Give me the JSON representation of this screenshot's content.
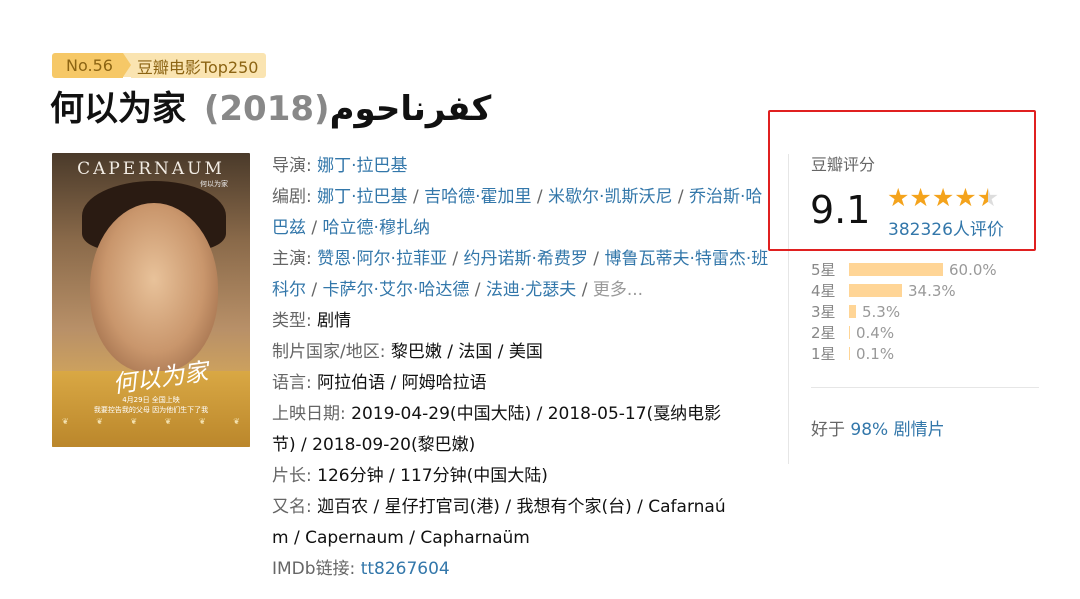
{
  "badge": {
    "rank": "No.56",
    "list": "豆瓣电影Top250"
  },
  "title": {
    "name": "何以为家 كفرناحوم",
    "year": "(2018)"
  },
  "poster": {
    "title_en": "CAPERNAUM",
    "title_en_sub": "何以为家",
    "title_zh": "何以为家",
    "release_line": "4月29日 全国上映",
    "tagline": "我要控告我的父母 因为他们生下了我"
  },
  "info": {
    "director_label": "导演: ",
    "director": "娜丁·拉巴基",
    "writer_label": "编剧: ",
    "writers": [
      "娜丁·拉巴基",
      "吉哈德·霍加里",
      "米歇尔·凯斯沃尼",
      "乔治斯·哈巴兹",
      "哈立德·穆扎纳"
    ],
    "cast_label": "主演: ",
    "cast": [
      "赞恩·阿尔·拉菲亚",
      "约丹诺斯·希费罗",
      "博鲁瓦蒂夫·特雷杰·班科尔",
      "卡萨尔·艾尔·哈达德",
      "法迪·尤瑟夫"
    ],
    "more": "更多...",
    "genre_label": "类型: ",
    "genre": "剧情",
    "country_label": "制片国家/地区: ",
    "country": "黎巴嫩 / 法国 / 美国",
    "language_label": "语言: ",
    "language": "阿拉伯语 / 阿姆哈拉语",
    "release_label": "上映日期: ",
    "release_line1": "2019-04-29(中国大陆) / 2018-05-17(戛纳电影",
    "release_line2": "节) / 2018-09-20(黎巴嫩)",
    "runtime_label": "片长: ",
    "runtime": "126分钟 / 117分钟(中国大陆)",
    "aka_label": "又名: ",
    "aka_line1": "迦百农 / 星仔打官司(港) / 我想有个家(台) / Cafarnaú",
    "aka_line2": "m / Capernaum / Capharnaüm",
    "imdb_label": "IMDb链接: ",
    "imdb": "tt8267604",
    "sep": " / "
  },
  "rating": {
    "label": "豆瓣评分",
    "score": "9.1",
    "stars": 4.5,
    "count": "382326人评价",
    "distribution": [
      {
        "star": "5星",
        "percent": "60.0%",
        "value": 60.0
      },
      {
        "star": "4星",
        "percent": "34.3%",
        "value": 34.3
      },
      {
        "star": "3星",
        "percent": "5.3%",
        "value": 5.3
      },
      {
        "star": "2星",
        "percent": "0.4%",
        "value": 0.4
      },
      {
        "star": "1星",
        "percent": "0.1%",
        "value": 0.1
      }
    ],
    "better_prefix": "好于 ",
    "better_link": "98% 剧情片"
  },
  "colors": {
    "link": "#3377aa",
    "star": "#f4a31c",
    "bar": "#ffd596",
    "highlight": "#e02020",
    "badge": "#f6c867"
  }
}
